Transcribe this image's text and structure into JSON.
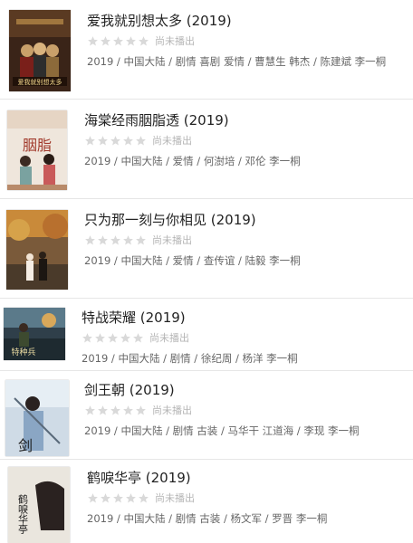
{
  "list": {
    "items": [
      {
        "title": "爱我就别想太多 (2019)",
        "rating_text": "尚未播出",
        "meta": "2019 / 中国大陆 / 剧情 喜剧 爱情 / 曹慧生 韩杰 / 陈建斌 李一桐",
        "poster_text": "爱我就别想太多"
      },
      {
        "title": "海棠经雨胭脂透 (2019)",
        "rating_text": "尚未播出",
        "meta": "2019 / 中国大陆 / 爱情 / 何澍培 / 邓伦 李一桐",
        "poster_text": "胭脂"
      },
      {
        "title": "只为那一刻与你相见 (2019)",
        "rating_text": "尚未播出",
        "meta": "2019 / 中国大陆 / 爱情 / 查传谊 / 陆毅 李一桐",
        "poster_text": ""
      },
      {
        "title": "特战荣耀 (2019)",
        "rating_text": "尚未播出",
        "meta": "2019 / 中国大陆 / 剧情 / 徐纪周 / 杨洋 李一桐",
        "poster_text": "特种兵"
      },
      {
        "title": "剑王朝 (2019)",
        "rating_text": "尚未播出",
        "meta": "2019 / 中国大陆 / 剧情 古装 / 马华干 江道海 / 李现 李一桐",
        "poster_text": "剑"
      },
      {
        "title": "鹤唳华亭 (2019)",
        "rating_text": "尚未播出",
        "meta": "2019 / 中国大陆 / 剧情 古装 / 杨文军 / 罗晋 李一桐",
        "poster_text": "鹤唳华亭"
      }
    ]
  },
  "colors": {
    "star_empty": "#d9d9d9",
    "title": "#222222",
    "meta": "#666666",
    "muted": "#b5b5b5",
    "divider": "#e6e6e6"
  }
}
